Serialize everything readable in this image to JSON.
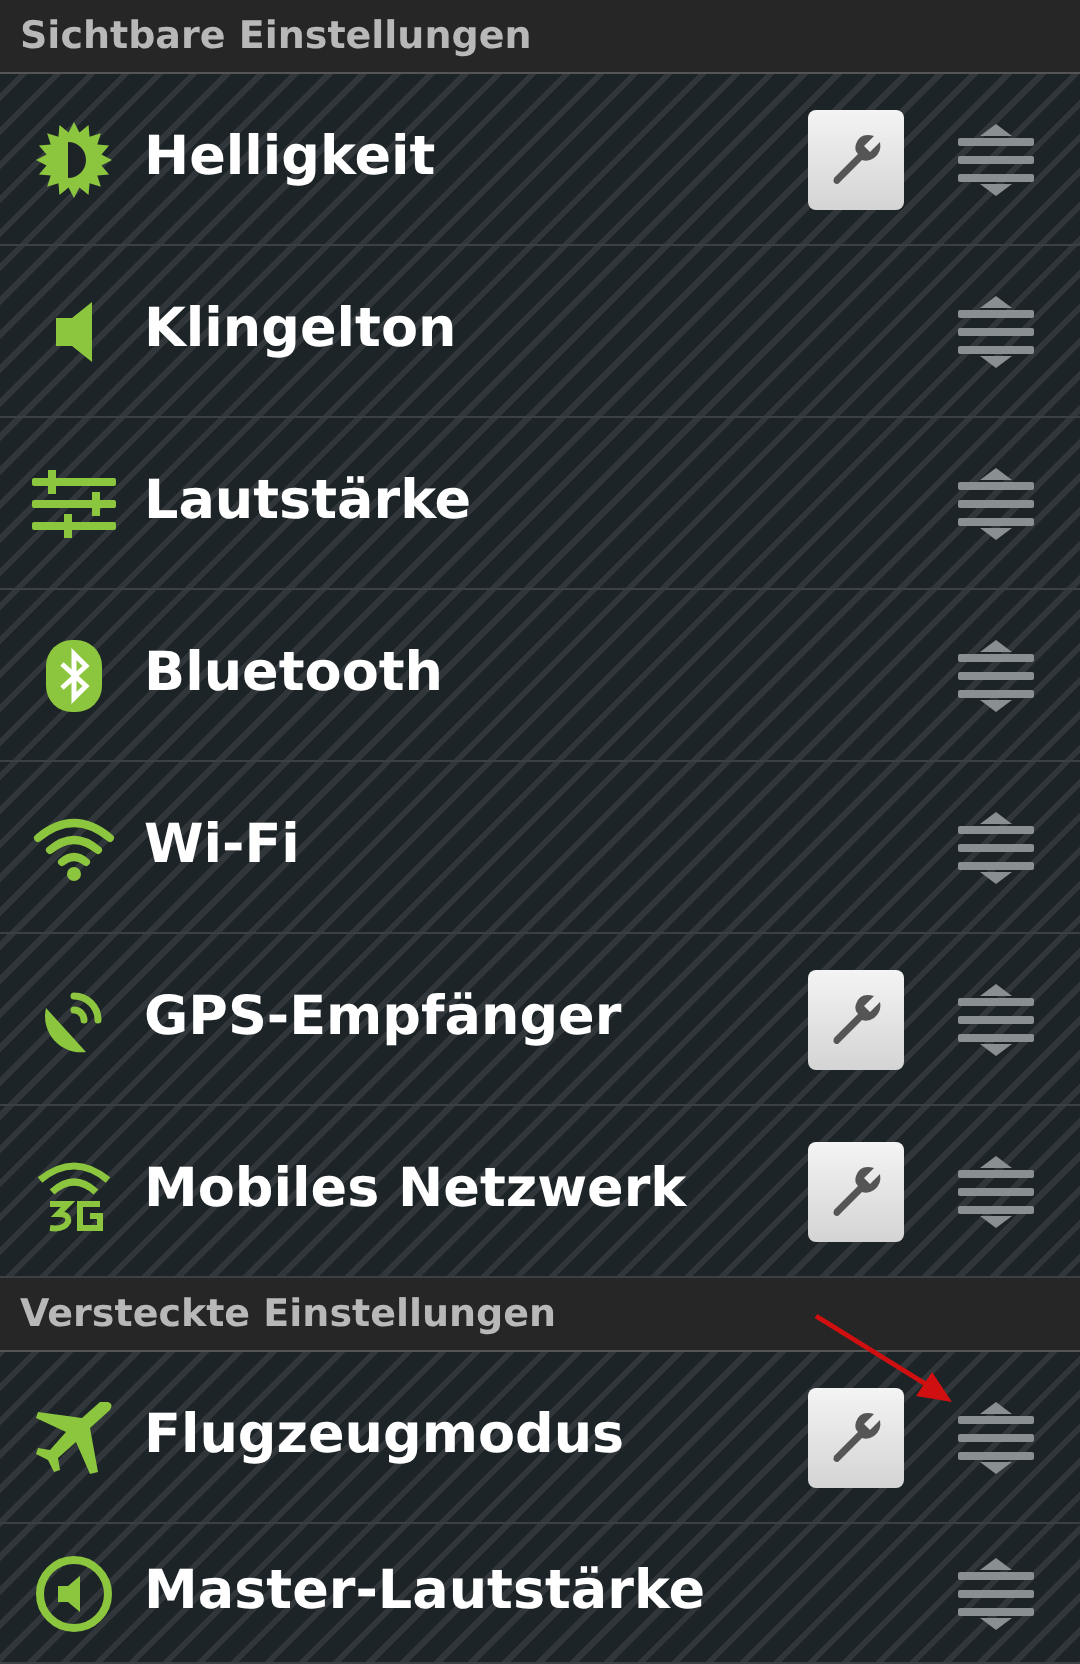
{
  "sections": [
    {
      "title": "Sichtbare Einstellungen",
      "items": [
        {
          "kind": "brightness",
          "label": "Helligkeit",
          "settings_button": true,
          "pointer_arrow": false
        },
        {
          "kind": "ringtone",
          "label": "Klingelton",
          "settings_button": false,
          "pointer_arrow": false
        },
        {
          "kind": "volume",
          "label": "Lautstärke",
          "settings_button": false,
          "pointer_arrow": false
        },
        {
          "kind": "bluetooth",
          "label": "Bluetooth",
          "settings_button": false,
          "pointer_arrow": false
        },
        {
          "kind": "wifi",
          "label": "Wi-Fi",
          "settings_button": false,
          "pointer_arrow": false
        },
        {
          "kind": "gps",
          "label": "GPS-Empfänger",
          "settings_button": true,
          "pointer_arrow": false
        },
        {
          "kind": "mobile",
          "label": "Mobiles Netzwerk",
          "settings_button": true,
          "pointer_arrow": false
        }
      ]
    },
    {
      "title": "Versteckte Einstellungen",
      "items": [
        {
          "kind": "airplane",
          "label": "Flugzeugmodus",
          "settings_button": true,
          "pointer_arrow": true
        },
        {
          "kind": "master",
          "label": "Master-Lautstärke",
          "settings_button": false,
          "pointer_arrow": false
        }
      ]
    }
  ]
}
